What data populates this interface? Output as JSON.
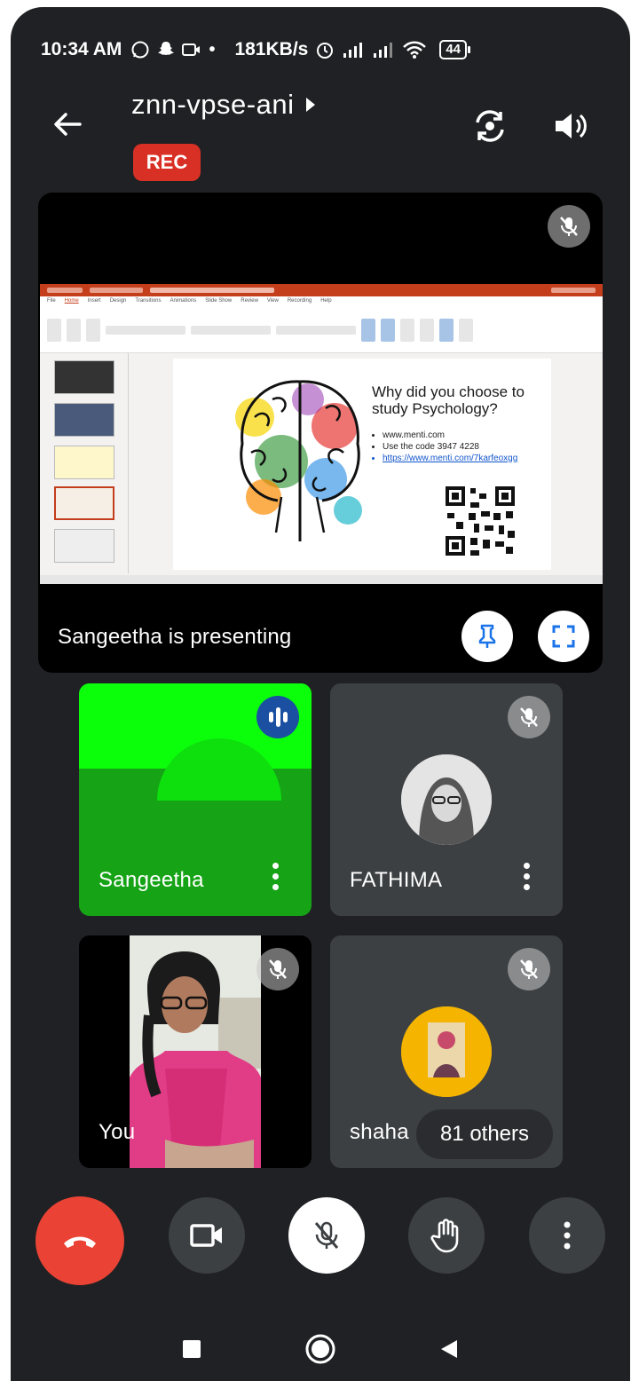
{
  "status_bar": {
    "time": "10:34 AM",
    "net_speed": "181KB/s",
    "battery": "44"
  },
  "header": {
    "meeting_code": "znn-vpse-ani",
    "recording_badge": "REC"
  },
  "presentation": {
    "label": "Sangeetha is presenting",
    "slide": {
      "question": "Why did you choose to study Psychology?",
      "bullets": [
        "www.menti.com",
        "Use the code 3947 4228",
        "https://www.menti.com/7karfeoxgg"
      ]
    }
  },
  "participants": [
    {
      "name": "Sangeetha",
      "speaking": true
    },
    {
      "name": "FATHIMA",
      "muted": true
    },
    {
      "name": "You",
      "muted": true
    },
    {
      "name": "shaha",
      "muted": true
    }
  ],
  "others_chip": "81 others",
  "colors": {
    "background": "#202124",
    "tile": "#3c4043",
    "end_call": "#ea4335",
    "rec": "#d93025",
    "speaking": "#1a4fa1",
    "green_tile": "#16a316"
  }
}
